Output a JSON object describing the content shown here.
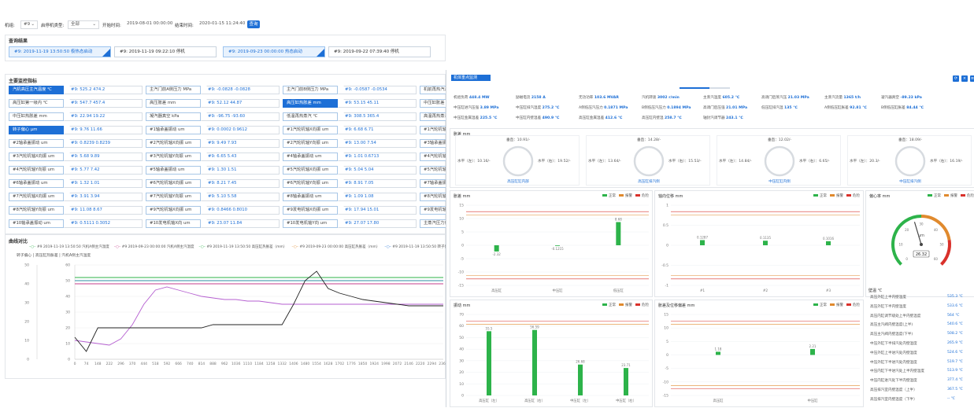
{
  "filter": {
    "unit_label": "机组:",
    "unit_value": "#9",
    "type_label": "启停机类型:",
    "type_value": "全部",
    "start_label": "开始时间:",
    "start_value": "2019-08-01 00:00:00",
    "end_label": "结束时间:",
    "end_value": "2020-01-15 11:24:40",
    "query_btn": "查询"
  },
  "results": {
    "title": "查询结果",
    "items": [
      {
        "text": "#9: 2019-11-19 13:50:50  极热态启动",
        "selected": true
      },
      {
        "text": "#9: 2019-11-19 09:22:10  停机",
        "selected": false
      },
      {
        "text": "#9: 2019-09-23 00:00:00  热态启动",
        "selected": true
      },
      {
        "text": "#9: 2019-09-22 07:39:40  停机",
        "selected": false
      }
    ]
  },
  "indicators": {
    "title": "主要监控指标",
    "rows": [
      [
        {
          "l": "汽机高压主汽温度 ℃",
          "v": "#9: 525.2  474.2",
          "on": true
        },
        {
          "l": "主汽门前A侧压力 MPa",
          "v": "#9: -0.0828  -0.0828",
          "on": false
        },
        {
          "l": "主汽门前B侧压力 MPa",
          "v": "#9: -0.0587  -0.0534",
          "on": false
        },
        {
          "l": "机前再热汽温",
          "v": "",
          "on": false
        }
      ],
      [
        {
          "l": "高压缸第一级内 ℃",
          "v": "#9: 547.7  457.4",
          "on": false
        },
        {
          "l": "高压胀差 mm",
          "v": "#9: 52.12  44.87",
          "on": false
        },
        {
          "l": "高压缸热胀差 mm",
          "v": "#9: 53.15  45.11",
          "on": true
        },
        {
          "l": "中压缸胀差",
          "v": "",
          "on": false
        }
      ],
      [
        {
          "l": "中压缸热胀差 mm",
          "v": "#9: 22.94  19.22",
          "on": false
        },
        {
          "l": "凝汽器真空 kPa",
          "v": "#9: -96.75  -93.60",
          "on": false
        },
        {
          "l": "低温再热蒸汽 ℃",
          "v": "#9: 308.5  365.4",
          "on": false
        },
        {
          "l": "高温再热蒸汽",
          "v": "",
          "on": false
        }
      ],
      [
        {
          "l": "转子偏心 μm",
          "v": "#9: 9.76  11.66",
          "on": true
        },
        {
          "l": "#1轴承盖振动 um",
          "v": "#9: 0.0002  0.9612",
          "on": false
        },
        {
          "l": "#1汽轮机轴X向振 um",
          "v": "#9: 6.68  6.71",
          "on": false
        },
        {
          "l": "#1汽轮机轴Y向",
          "v": "",
          "on": false
        }
      ],
      [
        {
          "l": "#2轴承盖振动 um",
          "v": "#9: 0.8239  0.8239",
          "on": false
        },
        {
          "l": "#2汽轮机轴X向振 um",
          "v": "#9: 9.49  7.93",
          "on": false
        },
        {
          "l": "#2汽轮机轴Y向振 um",
          "v": "#9: 13.00  7.54",
          "on": false
        },
        {
          "l": "#3轴承盖振动",
          "v": "",
          "on": false
        }
      ],
      [
        {
          "l": "#3汽轮机轴X向振 um",
          "v": "#9: 5.68  9.89",
          "on": false
        },
        {
          "l": "#3汽轮机轴Y向振 um",
          "v": "#9: 6.65  5.43",
          "on": false
        },
        {
          "l": "#4轴承盖振动 um",
          "v": "#9: 1.01  0.6713",
          "on": false
        },
        {
          "l": "#4汽轮机轴X向",
          "v": "",
          "on": false
        }
      ],
      [
        {
          "l": "#4汽轮机轴Y向振 um",
          "v": "#9: 5.77  7.42",
          "on": false
        },
        {
          "l": "#5轴承盖振动 um",
          "v": "#9: 1.30  1.51",
          "on": false
        },
        {
          "l": "#5汽轮机轴X向振 um",
          "v": "#9: 5.04  5.04",
          "on": false
        },
        {
          "l": "#5汽轮机轴Y向",
          "v": "",
          "on": false
        }
      ],
      [
        {
          "l": "#6轴承盖振动 um",
          "v": "#9: 1.32  1.01",
          "on": false
        },
        {
          "l": "#6汽轮机轴X向振 um",
          "v": "#9: 8.21  7.45",
          "on": false
        },
        {
          "l": "#6汽轮机轴Y向振 um",
          "v": "#9: 8.91  7.05",
          "on": false
        },
        {
          "l": "#7轴承盖振动",
          "v": "",
          "on": false
        }
      ],
      [
        {
          "l": "#7汽轮机轴X向振 um",
          "v": "#9: 3.91  3.94",
          "on": false
        },
        {
          "l": "#7汽轮机轴Y向振 um",
          "v": "#9: 5.10  5.58",
          "on": false
        },
        {
          "l": "#8轴承盖振动 um",
          "v": "#9: 1.09  1.08",
          "on": false
        },
        {
          "l": "#8汽轮机轴X向",
          "v": "",
          "on": false
        }
      ],
      [
        {
          "l": "#8汽轮机轴Y向振 um",
          "v": "#9: 11.08  8.67",
          "on": false
        },
        {
          "l": "#9汽轮机轴X向振 um",
          "v": "#9: 0.8466  0.8010",
          "on": false
        },
        {
          "l": "#9发电机轴X向振 um",
          "v": "#9: 17.94  15.01",
          "on": false
        },
        {
          "l": "#9发电机轴Y向",
          "v": "",
          "on": false
        }
      ],
      [
        {
          "l": "#10轴承盖振动 um",
          "v": "#9: 0.5111  0.3052",
          "on": false
        },
        {
          "l": "#10发电机轴X向 um",
          "v": "#9: 23.07  11.84",
          "on": false
        },
        {
          "l": "#10发电机轴Y向 um",
          "v": "#9: 27.07  17.80",
          "on": false
        },
        {
          "l": "主蒸汽压力值",
          "v": "",
          "on": false
        }
      ]
    ]
  },
  "curve": {
    "title": "曲线对比",
    "legend": [
      {
        "t": "#9 2019-11-19 13:50:50 汽机A侧主汽温度",
        "c": "#2db34a"
      },
      {
        "t": "#9 2019-09-23 00:00:00 汽机A侧主汽温度",
        "c": "#c43f8c"
      },
      {
        "t": "#9 2019-11-19 13:50:50 高压缸热胀差（mm）",
        "c": "#2db34a"
      },
      {
        "t": "#9 2019-09-23 00:00:00 高压缸热胀差（mm）",
        "c": "#e08a2e"
      },
      {
        "t": "#9 2019-11-19 13:50:50 转子偏",
        "c": "#1d6fd6"
      }
    ],
    "axis_note": "转子偏心 | 高压缸热胀差 | 汽机A侧主汽温度",
    "y1": [
      "50",
      "40",
      "30",
      "20",
      "10",
      "0"
    ],
    "y2": [
      "60",
      "50",
      "40",
      "30",
      "20",
      "10",
      "0"
    ],
    "x": [
      "0",
      "74",
      "148",
      "222",
      "296",
      "370",
      "444",
      "518",
      "592",
      "666",
      "740",
      "814",
      "888",
      "962",
      "1036",
      "1110",
      "1184",
      "1258",
      "1332",
      "1406",
      "1480",
      "1554",
      "1628",
      "1702",
      "1776",
      "1850",
      "1924",
      "1998",
      "2072",
      "2146",
      "2220",
      "2294",
      "2368"
    ]
  },
  "monitor": {
    "title": "机体重点监测",
    "kv_rows": [
      [
        {
          "k": "机组负荷",
          "v": "448.4 MW"
        },
        {
          "k": "励磁电流",
          "v": "2158 A"
        },
        {
          "k": "无功功率",
          "v": "103.6 MVAR"
        },
        {
          "k": "汽机转速",
          "v": "3002 r/min"
        },
        {
          "k": "主蒸汽温度",
          "v": "605.2 ℃"
        },
        {
          "k": "高调门后蒸汽压",
          "v": "21.03 MPa"
        },
        {
          "k": "主蒸汽流量",
          "v": "1365 t/h"
        },
        {
          "k": "凝汽器真空",
          "v": "-89.23 kPa"
        }
      ],
      [
        {
          "k": "中压缸进汽压强",
          "v": "3.89 MPa"
        },
        {
          "k": "中压缸排汽温度",
          "v": "275.2 ℃"
        },
        {
          "k": "A侧低压汽压力",
          "v": "0.1871 MPa"
        },
        {
          "k": "B侧低压汽压力",
          "v": "0.1894 MPa"
        },
        {
          "k": "高调门后压强",
          "v": "21.01 MPa"
        },
        {
          "k": "低压缸排汽温",
          "v": "135 ℃"
        },
        {
          "k": "A侧低压缸胀差",
          "v": "92.81 ℃"
        },
        {
          "k": "B侧低压缸胀差",
          "v": "84.44 ℃"
        }
      ],
      [
        {
          "k": "中压缸金属温差",
          "v": "225.5 ℃"
        },
        {
          "k": "中压缸内壁温差",
          "v": "490.9 ℃"
        },
        {
          "k": "高压缸金属温差",
          "v": "412.6 ℃"
        },
        {
          "k": "高压缸内壁温",
          "v": "258.7 ℃"
        },
        {
          "k": "轴封汽调节器",
          "v": "243.1 ℃"
        }
      ]
    ],
    "gauge_section": "胀差 mm",
    "gauges": [
      {
        "top": "垂直：10.91/-",
        "left": "水平（左）：10.16/-",
        "right": "水平（右）：19.52/-",
        "name": "高压缸缸内部"
      },
      {
        "top": "垂直：14.28/-",
        "left": "水平（左）：13.64/-",
        "right": "水平（右）：15.53/-",
        "name": "高压缸排汽侧"
      },
      {
        "top": "垂直：12.02/-",
        "left": "水平（左）：14.84/-",
        "right": "水平（右）：6.65/-",
        "name": "中压缸缸内侧"
      },
      {
        "top": "垂直：18.09/-",
        "left": "水平（左）：20.3/-",
        "right": "水平（右）：16.19/-",
        "name": "中压缸排汽侧"
      }
    ],
    "legend_items": [
      {
        "t": "正常",
        "c": "#2db34a"
      },
      {
        "t": "报警",
        "c": "#e08a2e"
      },
      {
        "t": "危险",
        "c": "#d9312b"
      }
    ],
    "chart1": {
      "title": "胀差 mm",
      "y": [
        "15",
        "10",
        "5",
        "0",
        "-5",
        "-10",
        "-15"
      ],
      "cats": [
        "高压缸",
        "中压缸",
        "低压缸"
      ],
      "values": [
        -2.32,
        -0.1215,
        8.68
      ],
      "labels": [
        "-2.32",
        "-0.1215",
        "8.68"
      ],
      "ymin": -15,
      "ymax": 15
    },
    "chart2": {
      "title": "轴向位移 mm",
      "y": [
        "1",
        "0.5",
        "0",
        "-0.5",
        "-1"
      ],
      "cats": [
        "#1",
        "#2",
        "#3"
      ],
      "values": [
        0.1287,
        0.1135,
        0.1016
      ],
      "labels": [
        "0.1287",
        "0.1135",
        "0.1016"
      ],
      "ymin": -1,
      "ymax": 1
    },
    "gauge3": {
      "title": "偏心率 mm",
      "unit": "μm",
      "value": "26.32",
      "ticks": [
        "0",
        "10",
        "20",
        "30",
        "40",
        "50",
        "60"
      ]
    },
    "chart4": {
      "title": "振动 mm",
      "y": [
        "70",
        "60",
        "50",
        "40",
        "30",
        "20",
        "10",
        "0"
      ],
      "cats": [
        "高压缸（左）",
        "高压缸（右）",
        "中压缸（左）",
        "中压缸（右）"
      ],
      "values": [
        55.5,
        56.59,
        26.68,
        23.71
      ],
      "labels": [
        "55.5",
        "56.59",
        "26.68",
        "23.71"
      ],
      "ymin": 0,
      "ymax": 70
    },
    "chart5": {
      "title": "胀差及位移偏差 mm",
      "y": [
        "15",
        "10",
        "5",
        "0",
        "-5",
        "-10",
        "-15"
      ],
      "cats": [
        "高压缸",
        "中压缸"
      ],
      "values": [
        1.18,
        2.21
      ],
      "labels": [
        "1.18",
        "2.21"
      ],
      "ymin": -15,
      "ymax": 15
    },
    "temp_title": "壁温 ℃",
    "temps": [
      {
        "k": "高压外缸上半内壁温度",
        "v": "535.3 ℃"
      },
      {
        "k": "高压外缸下半内壁温度",
        "v": "533.6 ℃"
      },
      {
        "k": "高压内缸调节级处上半内壁温度",
        "v": "564 ℃"
      },
      {
        "k": "高压主汽阀内壁温度(上半)",
        "v": "540.6 ℃"
      },
      {
        "k": "高压主汽阀内壁温度(下半)",
        "v": "508.2 ℃"
      },
      {
        "k": "中压外缸下半排汽处内壁温度",
        "v": "265.9 ℃"
      },
      {
        "k": "中压外缸上半进汽处内壁温度",
        "v": "524.6 ℃"
      },
      {
        "k": "中压外缸下半进汽处内壁温度",
        "v": "519.7 ℃"
      },
      {
        "k": "中压内缸下半进汽处上半内壁温度",
        "v": "513.9 ℃"
      },
      {
        "k": "中压内缸进汽处下半内壁温度",
        "v": "377.4 ℃"
      },
      {
        "k": "高压排汽室内壁温度（上半）",
        "v": "367.5 ℃"
      },
      {
        "k": "高压排汽室内壁温度（下半）",
        "v": "-- ℃"
      }
    ]
  },
  "chart_data": [
    {
      "type": "line",
      "title": "曲线对比",
      "x": [
        0,
        74,
        148,
        222,
        296,
        370,
        444,
        518,
        592,
        666,
        740,
        814,
        888,
        962,
        1036,
        1110,
        1184,
        1258,
        1332,
        1406,
        1480,
        1554,
        1628,
        1702,
        1776,
        1850,
        1924,
        1998,
        2072,
        2146,
        2220,
        2294,
        2368
      ],
      "series": [
        {
          "name": "#9 2019-11-19 13:50:50 汽机A侧主汽温度",
          "values": [
            52,
            52,
            52,
            52,
            52,
            52,
            52,
            52,
            52,
            52,
            52,
            52,
            52,
            52,
            52,
            52,
            52,
            52,
            52,
            52,
            52,
            52,
            52,
            52,
            52,
            52,
            52,
            52,
            52,
            52,
            52,
            52,
            52
          ]
        },
        {
          "name": "#9 2019-09-23 00:00:00 汽机A侧主汽温度",
          "values": [
            48,
            48,
            48,
            48,
            48,
            48,
            48,
            48,
            48,
            48,
            48,
            48,
            48,
            48,
            48,
            48,
            48,
            48,
            48,
            48,
            48,
            48,
            48,
            48,
            48,
            48,
            48,
            48,
            48,
            48,
            48,
            48,
            48
          ]
        },
        {
          "name": "#9 2019-11-19 13:50:50 高压缸热胀差（mm）",
          "values": [
            50,
            50,
            50,
            50,
            50,
            50,
            50,
            50,
            50,
            50,
            50,
            50,
            50,
            50,
            50,
            50,
            50,
            50,
            50,
            50,
            50,
            50,
            50,
            50,
            50,
            50,
            50,
            50,
            50,
            50,
            50,
            50,
            50
          ]
        },
        {
          "name": "#9 2019-09-23 00:00:00 高压缸热胀差（mm）",
          "values": [
            12,
            11,
            10,
            9,
            13,
            22,
            35,
            44,
            46,
            44,
            42,
            40,
            39,
            38,
            38,
            37,
            37,
            36,
            35,
            35,
            35,
            35,
            35,
            35,
            35,
            35,
            35,
            35,
            35,
            35,
            35,
            35,
            35
          ]
        },
        {
          "name": "#9 2019-11-19 13:50:50 转子偏",
          "values": [
            14,
            5,
            20,
            20,
            20,
            20,
            20,
            20,
            20,
            20,
            20,
            20,
            22,
            22,
            22,
            22,
            22,
            22,
            22,
            35,
            50,
            56,
            45,
            42,
            40,
            38,
            37,
            36,
            35,
            34,
            34,
            34,
            34
          ]
        }
      ]
    },
    {
      "type": "bar",
      "title": "胀差 mm",
      "categories": [
        "高压缸",
        "中压缸",
        "低压缸"
      ],
      "values": [
        -2.32,
        -0.1215,
        8.68
      ],
      "ylim": [
        -15,
        15
      ]
    },
    {
      "type": "bar",
      "title": "轴向位移 mm",
      "categories": [
        "#1",
        "#2",
        "#3"
      ],
      "values": [
        0.1287,
        0.1135,
        0.1016
      ],
      "ylim": [
        -1,
        1
      ]
    },
    {
      "type": "bar",
      "title": "振动 mm",
      "categories": [
        "高压缸（左）",
        "高压缸（右）",
        "中压缸（左）",
        "中压缸（右）"
      ],
      "values": [
        55.5,
        56.59,
        26.68,
        23.71
      ],
      "ylim": [
        0,
        70
      ]
    },
    {
      "type": "bar",
      "title": "胀差及位移偏差 mm",
      "categories": [
        "高压缸",
        "中压缸"
      ],
      "values": [
        1.18,
        2.21
      ],
      "ylim": [
        -15,
        15
      ]
    }
  ]
}
